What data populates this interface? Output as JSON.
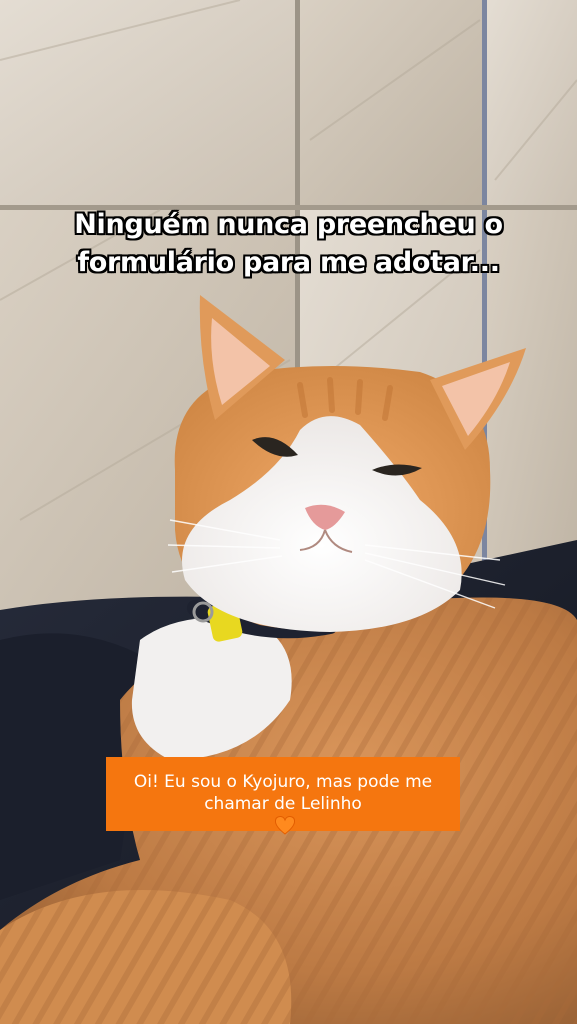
{
  "overlay": {
    "top_caption_line1": "Ninguém nunca preencheu o",
    "top_caption_line2": "formulário para me adotar...",
    "sticker_line1": "Oi! Eu sou o Kyojuro, mas pode me",
    "sticker_line2": "chamar de Lelinho",
    "sticker_color": "#f5760f",
    "heart_icon": "orange-heart-emoji"
  },
  "photo": {
    "subject": "orange-and-white-cat",
    "collar_tag_color": "#e8d820",
    "background": "beige-tiled-wall"
  }
}
